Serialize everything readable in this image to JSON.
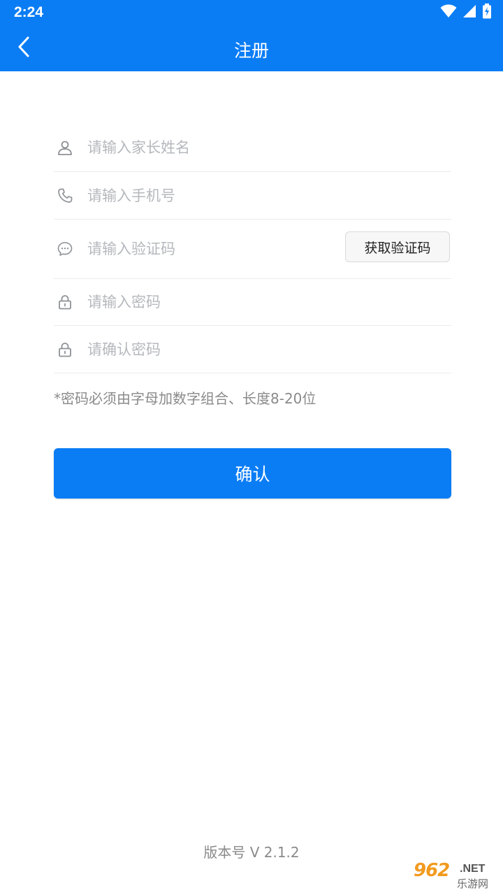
{
  "status_bar": {
    "time": "2:24",
    "icons": [
      "wifi-icon",
      "signal-icon",
      "battery-charging-icon"
    ]
  },
  "header": {
    "back_icon": "chevron-left-icon",
    "title": "注册",
    "bg_color": "#0a7df5"
  },
  "form": {
    "name": {
      "icon": "user-icon",
      "placeholder": "请输入家长姓名",
      "value": ""
    },
    "phone": {
      "icon": "phone-icon",
      "placeholder": "请输入手机号",
      "value": ""
    },
    "code": {
      "icon": "message-icon",
      "placeholder": "请输入验证码",
      "value": "",
      "button_label": "获取验证码"
    },
    "password": {
      "icon": "lock-icon",
      "placeholder": "请输入密码",
      "value": ""
    },
    "password_confirm": {
      "icon": "lock-icon",
      "placeholder": "请确认密码",
      "value": ""
    }
  },
  "hint": "*密码必须由字母加数字组合、长度8-20位",
  "confirm_label": "确认",
  "version": "版本号 V 2.1.2",
  "watermark": {
    "main": "962",
    "suffix": ".NET",
    "sub": "乐游网"
  }
}
